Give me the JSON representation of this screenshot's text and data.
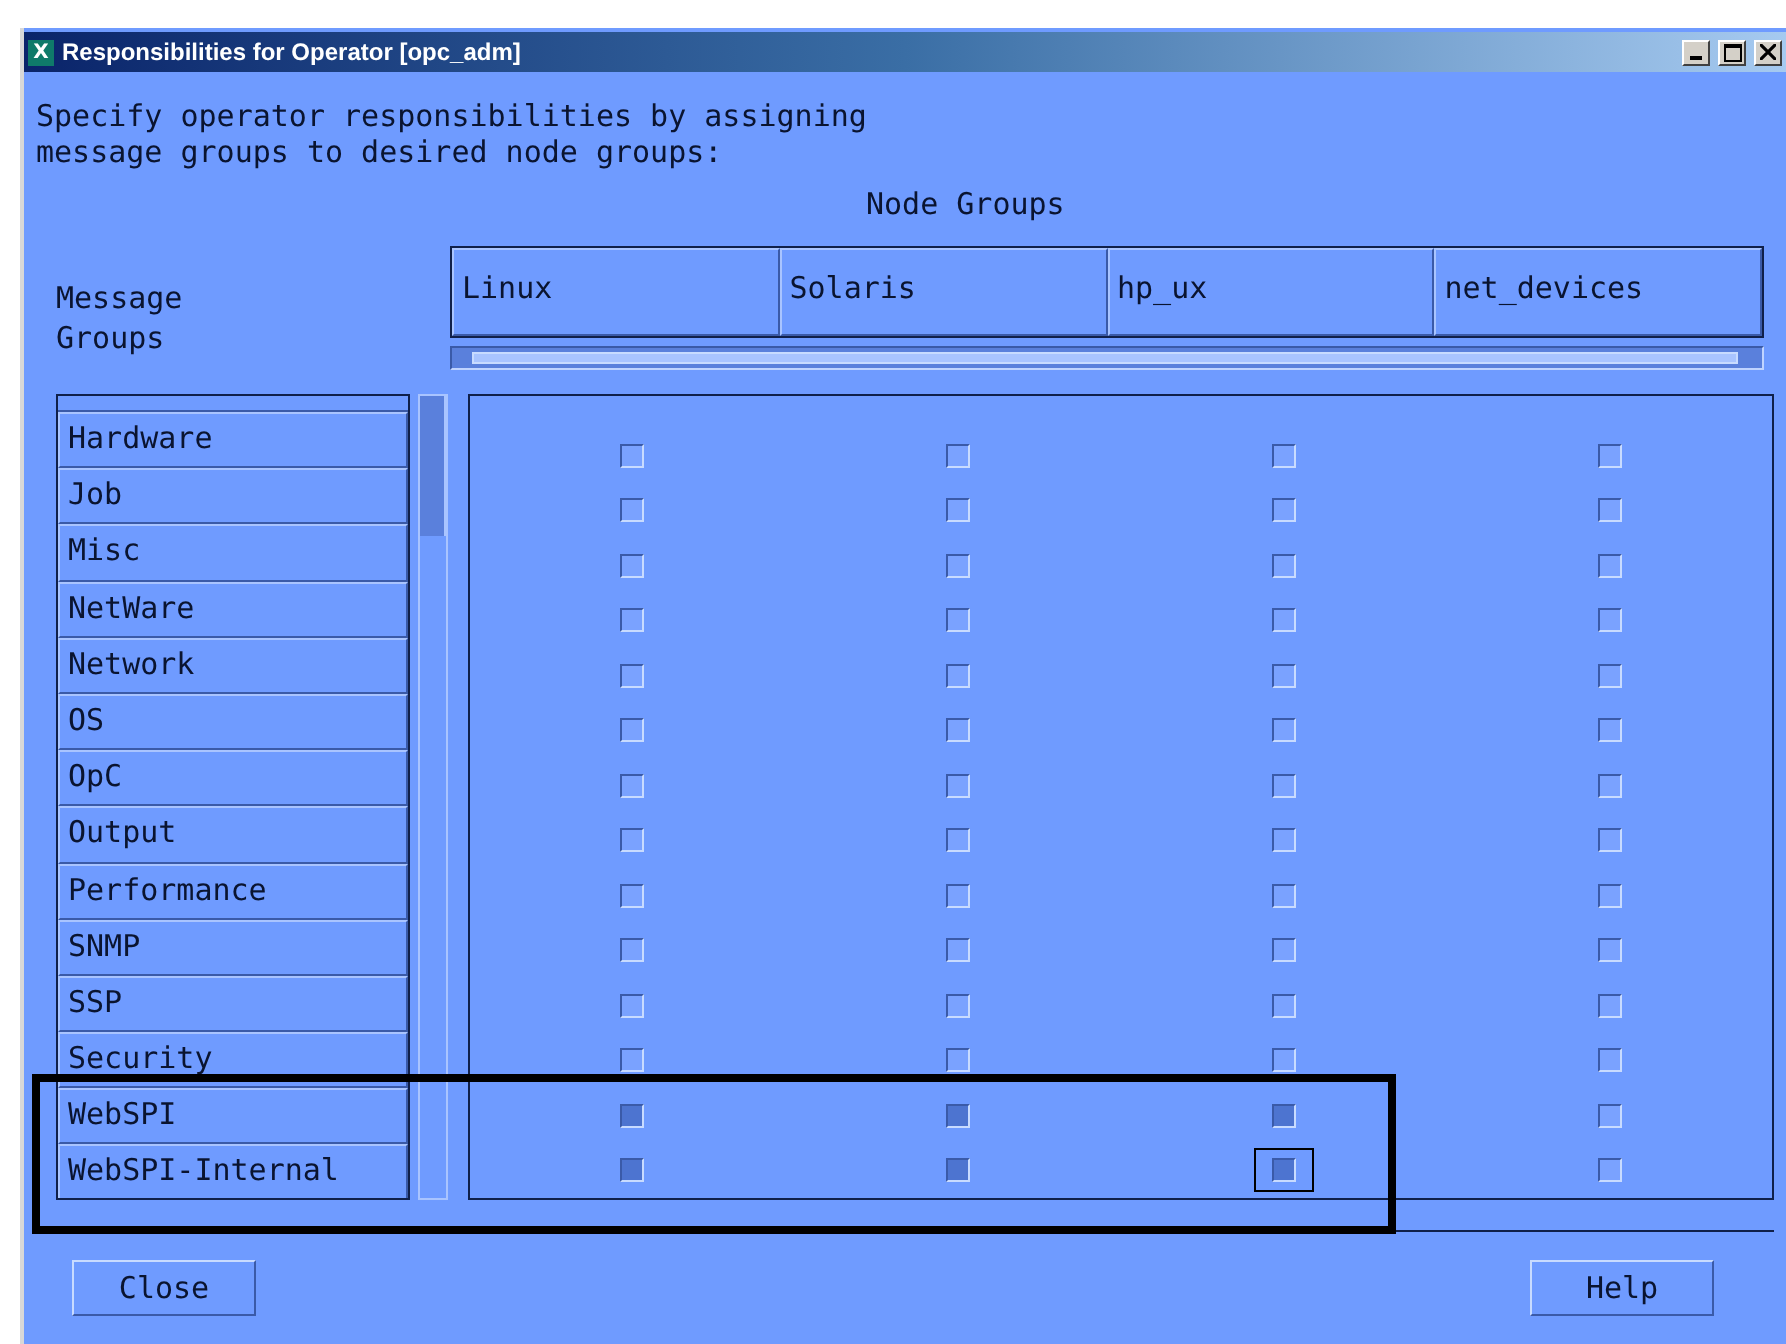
{
  "window": {
    "title": "Responsibilities for Operator [opc_adm]",
    "app_glyph": "X"
  },
  "instructions": [
    "Specify operator responsibilities by assigning",
    "message groups to desired node groups:"
  ],
  "node_groups_label": "Node Groups",
  "message_groups_label": [
    "Message",
    "Groups"
  ],
  "columns": [
    "Linux",
    "Solaris",
    "hp_ux",
    "net_devices"
  ],
  "rows": [
    {
      "name": "Hardware",
      "checks": [
        false,
        false,
        false,
        false
      ]
    },
    {
      "name": "Job",
      "checks": [
        false,
        false,
        false,
        false
      ]
    },
    {
      "name": "Misc",
      "checks": [
        false,
        false,
        false,
        false
      ]
    },
    {
      "name": "NetWare",
      "checks": [
        false,
        false,
        false,
        false
      ]
    },
    {
      "name": "Network",
      "checks": [
        false,
        false,
        false,
        false
      ]
    },
    {
      "name": "OS",
      "checks": [
        false,
        false,
        false,
        false
      ]
    },
    {
      "name": "OpC",
      "checks": [
        false,
        false,
        false,
        false
      ]
    },
    {
      "name": "Output",
      "checks": [
        false,
        false,
        false,
        false
      ]
    },
    {
      "name": "Performance",
      "checks": [
        false,
        false,
        false,
        false
      ]
    },
    {
      "name": "SNMP",
      "checks": [
        false,
        false,
        false,
        false
      ]
    },
    {
      "name": "SSP",
      "checks": [
        false,
        false,
        false,
        false
      ]
    },
    {
      "name": "Security",
      "checks": [
        false,
        false,
        false,
        false
      ]
    },
    {
      "name": "WebSPI",
      "checks": [
        true,
        true,
        true,
        false
      ]
    },
    {
      "name": "WebSPI-Internal",
      "checks": [
        true,
        true,
        true,
        false
      ],
      "focus": [
        false,
        false,
        true,
        false
      ]
    }
  ],
  "buttons": [
    "Close",
    "Help"
  ]
}
